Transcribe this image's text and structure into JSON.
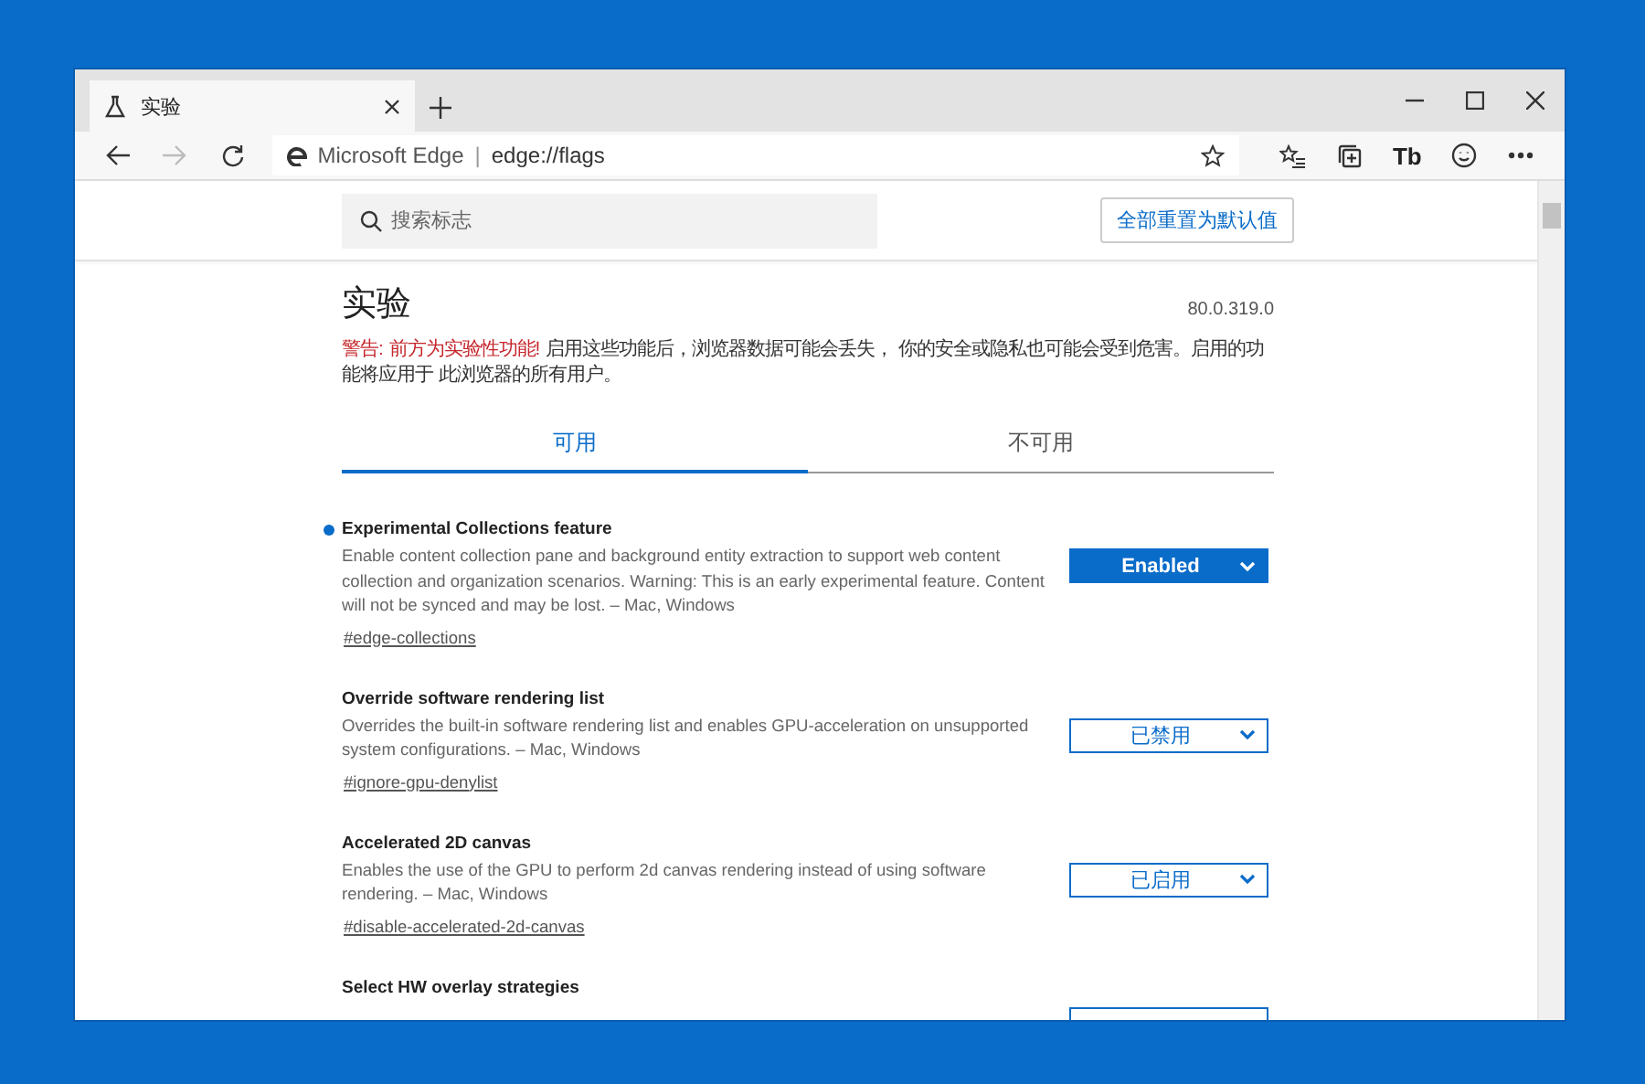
{
  "window": {
    "tab_title": "实验"
  },
  "address_bar": {
    "site_label": "Microsoft Edge",
    "separator": "|",
    "url": "edge://flags"
  },
  "toolbar": {
    "extension_label": "Tb"
  },
  "search": {
    "placeholder": "搜索标志"
  },
  "reset_button": "全部重置为默认值",
  "header": {
    "title": "实验",
    "version": "80.0.319.0",
    "warning_label": "警告: 前方为实验性功能!",
    "warning_text": " 启用这些功能后，浏览器数据可能会丢失， 你的安全或隐私也可能会受到危害。启用的功能将应用于 此浏览器的所有用户。"
  },
  "tabs": [
    {
      "label": "可用",
      "selected": true
    },
    {
      "label": "不可用",
      "selected": false
    }
  ],
  "flags": [
    {
      "name": "Experimental Collections feature",
      "description": "Enable content collection pane and background entity extraction to support web content collection and organization scenarios. Warning: This is an early experimental feature. Content will not be synced and may be lost. – Mac, Windows",
      "link": "#edge-collections",
      "value": "Enabled",
      "modified": true
    },
    {
      "name": "Override software rendering list",
      "description": "Overrides the built-in software rendering list and enables GPU-acceleration on unsupported system configurations. – Mac, Windows",
      "link": "#ignore-gpu-denylist",
      "value": "已禁用",
      "modified": false
    },
    {
      "name": "Accelerated 2D canvas",
      "description": "Enables the use of the GPU to perform 2d canvas rendering instead of using software rendering. – Mac, Windows",
      "link": "#disable-accelerated-2d-canvas",
      "value": "已启用",
      "modified": false
    },
    {
      "name": "Select HW overlay strategies",
      "modified": false
    }
  ]
}
